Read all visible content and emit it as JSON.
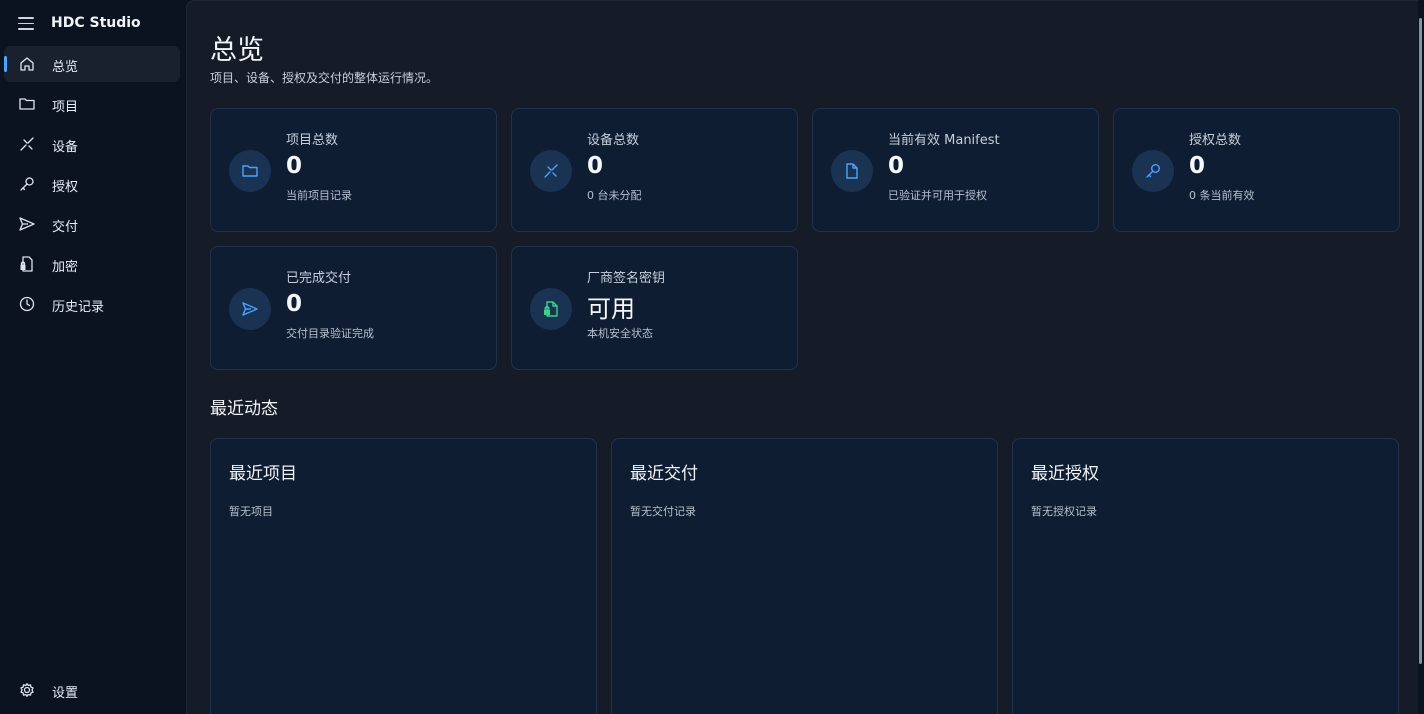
{
  "app": {
    "title": "HDC Studio"
  },
  "sidebar": {
    "items": [
      {
        "label": "总览",
        "icon": "home-icon",
        "active": true
      },
      {
        "label": "项目",
        "icon": "folder-icon"
      },
      {
        "label": "设备",
        "icon": "device-link-icon"
      },
      {
        "label": "授权",
        "icon": "key-icon"
      },
      {
        "label": "交付",
        "icon": "send-icon"
      },
      {
        "label": "加密",
        "icon": "lock-document-icon"
      },
      {
        "label": "历史记录",
        "icon": "clock-icon"
      }
    ],
    "settings_label": "设置"
  },
  "page": {
    "title": "总览",
    "subtitle": "项目、设备、授权及交付的整体运行情况。"
  },
  "stats": [
    {
      "label": "项目总数",
      "value": "0",
      "desc": "当前项目记录",
      "icon": "folder-icon"
    },
    {
      "label": "设备总数",
      "value": "0",
      "desc": "0 台未分配",
      "icon": "device-link-icon"
    },
    {
      "label": "当前有效 Manifest",
      "value": "0",
      "desc": "已验证并可用于授权",
      "icon": "document-icon"
    },
    {
      "label": "授权总数",
      "value": "0",
      "desc": "0 条当前有效",
      "icon": "key-icon"
    },
    {
      "label": "已完成交付",
      "value": "0",
      "desc": "交付目录验证完成",
      "icon": "send-icon"
    },
    {
      "label": "厂商签名密钥",
      "value": "可用",
      "desc": "本机安全状态",
      "icon": "lock-document-icon"
    }
  ],
  "recent": {
    "section_title": "最近动态",
    "cards": [
      {
        "title": "最近项目",
        "empty": "暂无项目"
      },
      {
        "title": "最近交付",
        "empty": "暂无交付记录"
      },
      {
        "title": "最近授权",
        "empty": "暂无授权记录"
      }
    ]
  },
  "colors": {
    "accent": "#4aa3ff",
    "success": "#3fd08a",
    "card_bg": "#0f1d32",
    "main_bg": "#151c28",
    "sidebar_bg": "#0b1220"
  }
}
